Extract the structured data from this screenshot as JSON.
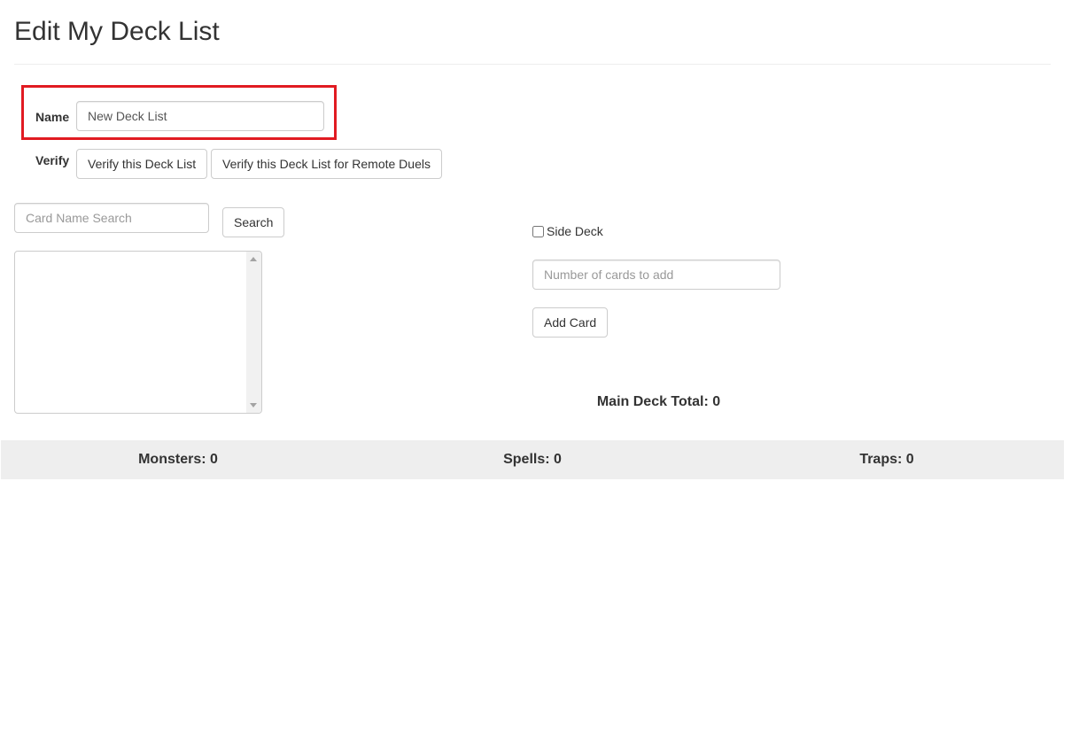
{
  "page": {
    "title": "Edit My Deck List"
  },
  "name_field": {
    "label": "Name",
    "value": "New Deck List"
  },
  "verify": {
    "label": "Verify",
    "verify_button": "Verify this Deck List",
    "verify_remote_button": "Verify this Deck List for Remote Duels"
  },
  "search": {
    "placeholder": "Card Name Search",
    "button": "Search"
  },
  "add_panel": {
    "side_deck_label": "Side Deck",
    "side_deck_checked": false,
    "count_placeholder": "Number of cards to add",
    "add_button": "Add Card"
  },
  "totals": {
    "main_deck": "Main Deck Total: 0",
    "monsters": "Monsters: 0",
    "spells": "Spells: 0",
    "traps": "Traps: 0"
  },
  "colors": {
    "highlight": "#e11b22",
    "summary_bar": "#eeeeee",
    "text": "#333333"
  }
}
